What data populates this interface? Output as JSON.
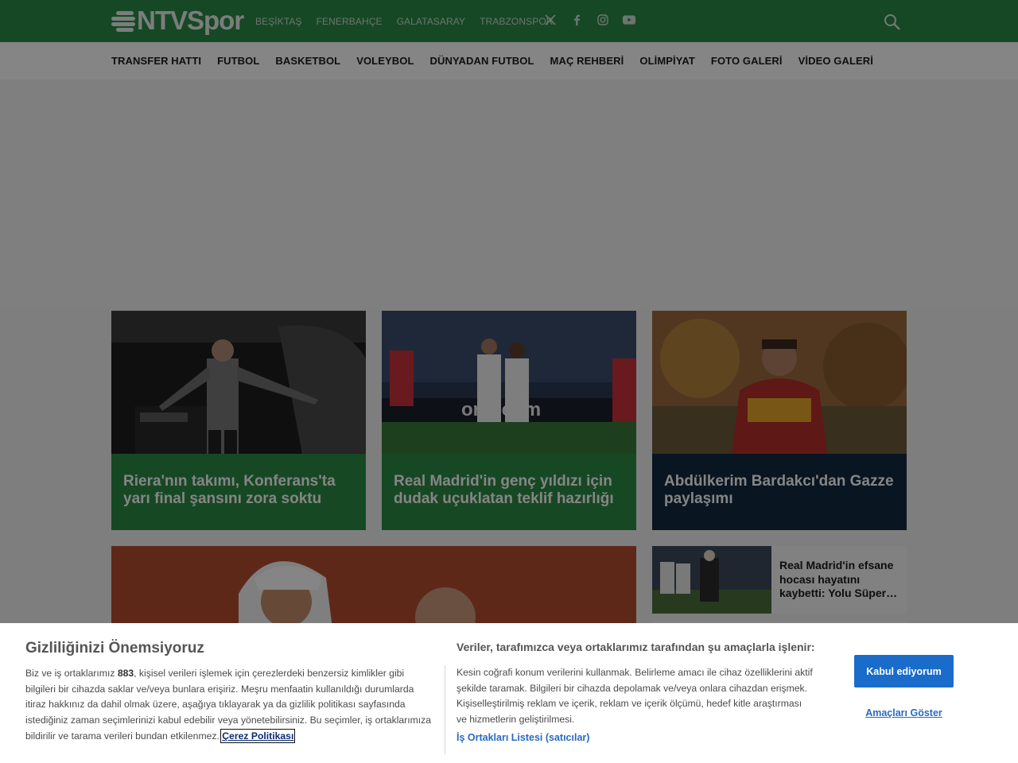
{
  "header": {
    "logo_text": "NTVSpor",
    "club_links": [
      "BEŞİKTAŞ",
      "FENERBAHÇE",
      "GALATASARAY",
      "TRABZONSPOR"
    ],
    "social_icons": [
      "x-icon",
      "facebook-icon",
      "instagram-icon",
      "youtube-icon"
    ],
    "search_icon": "search-icon",
    "colors": {
      "brand_green": "#2d8a47"
    }
  },
  "nav": {
    "items": [
      "TRANSFER HATTI",
      "FUTBOL",
      "BASKETBOL",
      "VOLEYBOL",
      "DÜNYADAN FUTBOL",
      "MAÇ REHBERİ",
      "OLİMPİYAT",
      "FOTO GALERİ",
      "VİDEO GALERİ"
    ]
  },
  "cards": [
    {
      "title": "Riera'nın takımı, Konferans'ta yarı final şansını zora soktu"
    },
    {
      "title": "Real Madrid'in genç yıldızı için dudak uçuklatan teklif hazırlığı"
    },
    {
      "title": "Abdülkerim Bardakcı'dan Gazze paylaşımı"
    }
  ],
  "side_cards": [
    {
      "title": "Real Madrid'in efsane hocası hayatını kaybetti: Yolu Süper…"
    }
  ],
  "consent": {
    "title": "Gizliliğinizi Önemsiyoruz",
    "body_prefix": "Biz ve iş ortaklarımız ",
    "partner_count": "883",
    "body_suffix": ", kişisel verileri işlemek için çerezlerdeki benzersiz kimlikler gibi bilgileri bir cihazda saklar ve/veya bunlara erişiriz. Meşru menfaatin kullanıldığı durumlarda itiraz hakkınız da dahil olmak üzere, aşağıya tıklayarak ya da gizlilik politikası sayfasında istediğiniz zaman seçimlerinizi kabul edebilir veya yönetebilirsiniz. Bu seçimler, iş ortaklarımıza bildirilir ve tarama verileri bundan etkilenmez. ",
    "policy_link": "Çerez Politikası",
    "subtitle": "Veriler, tarafımızca veya ortaklarımız tarafından şu amaçlarla işlenir:",
    "purposes": "Kesin coğrafi konum verilerini kullanmak. Belirleme amacı ile cihaz özelliklerini aktif şekilde taramak. Bilgileri bir cihazda depolamak ve/veya onlara cihazdan erişmek. Kişiselleştirilmiş reklam ve içerik, reklam ve içerik ölçümü, hedef kitle araştırması ve hizmetlerin geliştirilmesi.",
    "partners_link": "İş Ortakları Listesi (satıcılar)",
    "accept_button": "Kabul ediyorum",
    "show_purposes": "Amaçları Göster",
    "colors": {
      "button_blue": "#1a6ccb",
      "link_blue": "#2a6ac0"
    }
  }
}
